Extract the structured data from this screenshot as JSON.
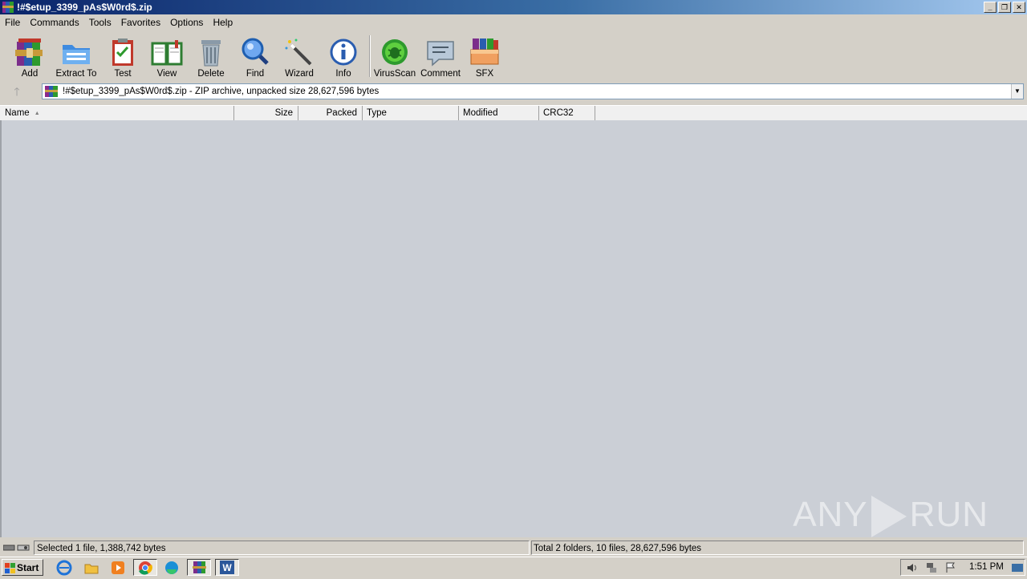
{
  "window": {
    "title": "!#$etup_3399_pAs$W0rd$.zip",
    "minimize": "_",
    "restore": "❐",
    "close": "✕"
  },
  "menu": [
    "File",
    "Commands",
    "Tools",
    "Favorites",
    "Options",
    "Help"
  ],
  "toolbar": [
    {
      "label": "Add",
      "icon": "add-archive-icon"
    },
    {
      "label": "Extract To",
      "icon": "extract-folder-icon"
    },
    {
      "label": "Test",
      "icon": "test-clipboard-icon"
    },
    {
      "label": "View",
      "icon": "view-book-icon"
    },
    {
      "label": "Delete",
      "icon": "trash-icon"
    },
    {
      "label": "Find",
      "icon": "magnifier-icon"
    },
    {
      "label": "Wizard",
      "icon": "wand-icon"
    },
    {
      "label": "Info",
      "icon": "info-icon"
    },
    {
      "label": "VirusScan",
      "icon": "bug-icon"
    },
    {
      "label": "Comment",
      "icon": "comment-icon"
    },
    {
      "label": "SFX",
      "icon": "sfx-box-icon"
    }
  ],
  "address": {
    "text": "!#$etup_3399_pAs$W0rd$.zip - ZIP archive, unpacked size 28,627,596 bytes",
    "up_arrow": "🡑",
    "dropdown": "▼"
  },
  "columns": {
    "name": "Name",
    "size": "Size",
    "packed": "Packed",
    "type": "Type",
    "modified": "Modified",
    "crc32": "CRC32"
  },
  "watermark": {
    "left": "ANY",
    "right": "RUN"
  },
  "status": {
    "left": "Selected 1 file, 1,388,742 bytes",
    "right": "Total 2 folders, 10 files, 28,627,596 bytes"
  },
  "taskbar": {
    "start": "Start",
    "clock": "1:51 PM"
  },
  "colors": {
    "titlebar_start": "#0a246a",
    "titlebar_end": "#a6caf0",
    "list_bg": "#cbcfd6",
    "face": "#d4d0c8"
  }
}
